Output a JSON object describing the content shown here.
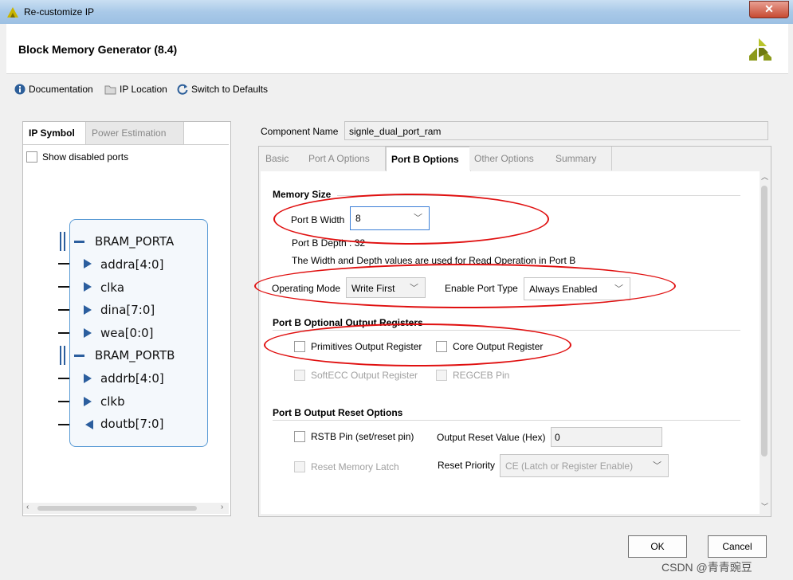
{
  "window": {
    "title": "Re-customize IP",
    "close_label": "✕"
  },
  "header": {
    "title": "Block Memory Generator (8.4)"
  },
  "toolbar": {
    "documentation": "Documentation",
    "ip_location": "IP Location",
    "switch_defaults": "Switch to Defaults"
  },
  "left_panel": {
    "tabs": [
      "IP Symbol",
      "Power Estimation"
    ],
    "show_disabled_ports": "Show disabled ports",
    "ports": [
      "BRAM_PORTA",
      "addra[4:0]",
      "clka",
      "dina[7:0]",
      "wea[0:0]",
      "BRAM_PORTB",
      "addrb[4:0]",
      "clkb",
      "doutb[7:0]"
    ]
  },
  "component": {
    "label": "Component Name",
    "value": "signle_dual_port_ram"
  },
  "tabs": [
    "Basic",
    "Port A Options",
    "Port B Options",
    "Other Options",
    "Summary"
  ],
  "memory_size": {
    "section": "Memory Size",
    "width_label": "Port B Width",
    "width_value": "8",
    "depth_text": "Port B Depth : 32",
    "note": "The Width and Depth values are used for Read Operation in Port B"
  },
  "operating": {
    "mode_label": "Operating Mode",
    "mode_value": "Write First",
    "enable_label": "Enable Port Type",
    "enable_value": "Always Enabled"
  },
  "optional_regs": {
    "section": "Port B Optional Output Registers",
    "primitives": "Primitives Output Register",
    "core": "Core Output Register",
    "softecc": "SoftECC Output Register",
    "regceb": "REGCEB Pin"
  },
  "reset": {
    "section": "Port B Output Reset Options",
    "rstb": "RSTB Pin (set/reset pin)",
    "reset_value_label": "Output Reset Value (Hex)",
    "reset_value": "0",
    "reset_latch": "Reset Memory Latch",
    "priority_label": "Reset Priority",
    "priority_value": "CE (Latch or Register Enable)"
  },
  "buttons": {
    "ok": "OK",
    "cancel": "Cancel"
  },
  "watermark": "CSDN @青青豌豆",
  "colors": {
    "annotation_red": "#e01010",
    "selected_border": "#3c7fd6"
  }
}
